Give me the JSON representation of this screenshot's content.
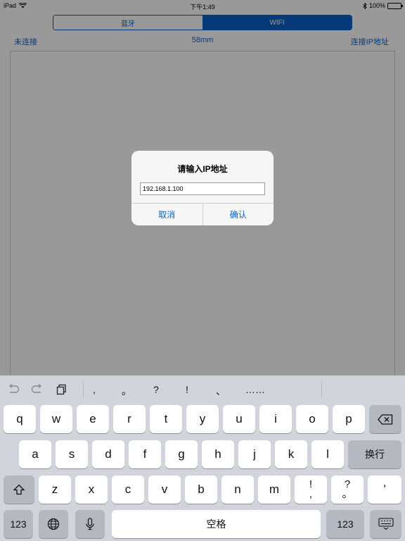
{
  "status_bar": {
    "device": "iPad",
    "time": "下午1:49",
    "battery": "100%",
    "battery_level": 1.0
  },
  "segmented": {
    "tabs": [
      "蓝牙",
      "WIFI"
    ],
    "selected": 1
  },
  "info_row": {
    "status": "未连接",
    "paper_width": "58mm",
    "connect_ip": "连接IP地址"
  },
  "alert": {
    "title": "请输入IP地址",
    "input_value": "192.168.1.100",
    "cancel": "取消",
    "confirm": "确认"
  },
  "keyboard": {
    "punctuation": [
      ",",
      "。",
      "?",
      "!",
      "、",
      "……"
    ],
    "row1": [
      "q",
      "w",
      "e",
      "r",
      "t",
      "y",
      "u",
      "i",
      "o",
      "p"
    ],
    "row2": [
      "a",
      "s",
      "d",
      "f",
      "g",
      "h",
      "j",
      "k",
      "l"
    ],
    "row2_return": "换行",
    "row3": [
      "z",
      "x",
      "c",
      "v",
      "b",
      "n",
      "m"
    ],
    "row3_dual": [
      {
        "top": "!",
        "bottom": ","
      },
      {
        "top": "?",
        "bottom": "。"
      }
    ],
    "row3_extra": "’",
    "numbers_left": "123",
    "space": "空格",
    "numbers_right": "123"
  }
}
